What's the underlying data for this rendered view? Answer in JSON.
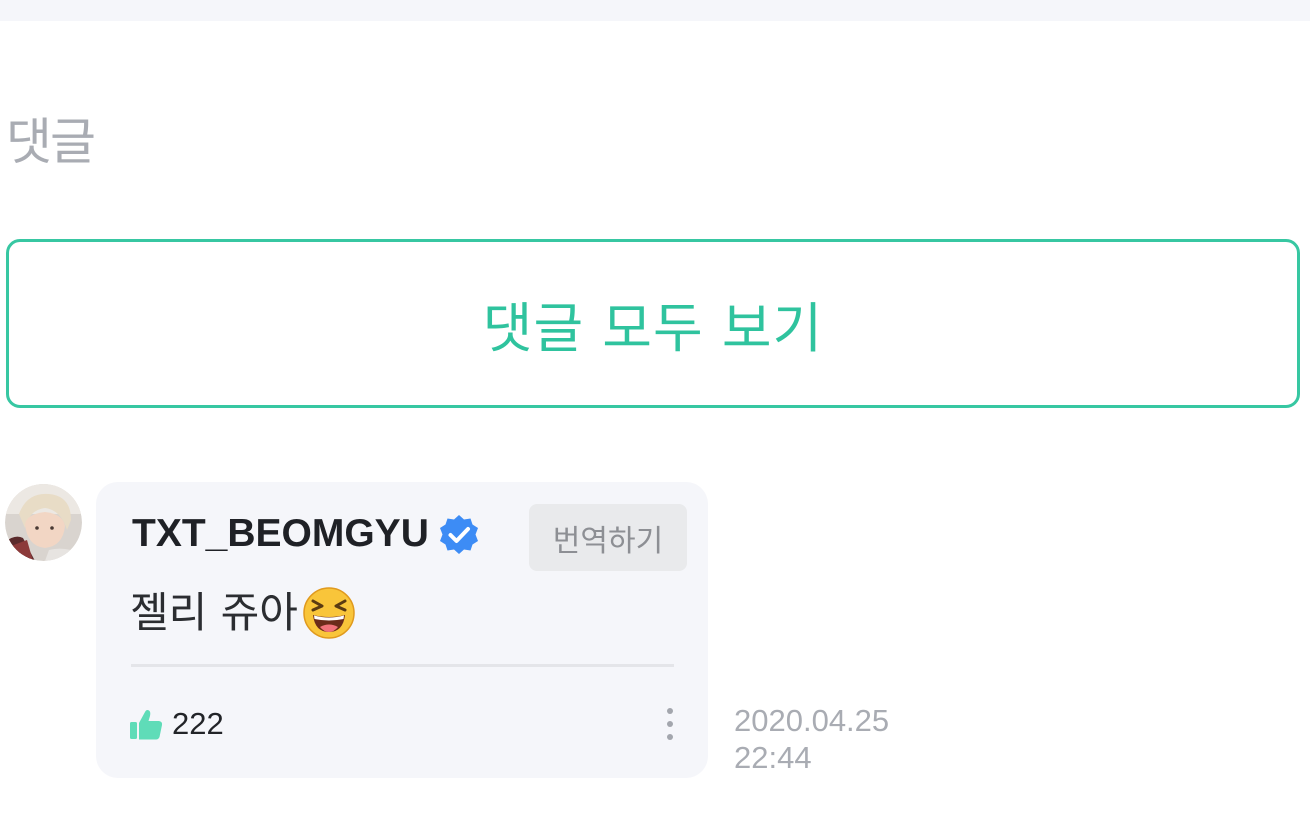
{
  "section": {
    "title": "댓글",
    "view_all_label": "댓글 모두 보기"
  },
  "comment": {
    "author": "TXT_BEOMGYU",
    "verified_icon": "verified-badge-icon",
    "translate_label": "번역하기",
    "text": "젤리 쥬아",
    "emoji_icon": "laughing-face-emoji",
    "likes": "222",
    "like_icon": "thumbs-up-icon",
    "more_icon": "vertical-ellipsis-icon",
    "date": "2020.04.25",
    "time": "22:44"
  },
  "colors": {
    "accent": "#37c7a2",
    "verified": "#3d8cf5",
    "like": "#5fdcb8",
    "muted": "#a9acb3"
  }
}
